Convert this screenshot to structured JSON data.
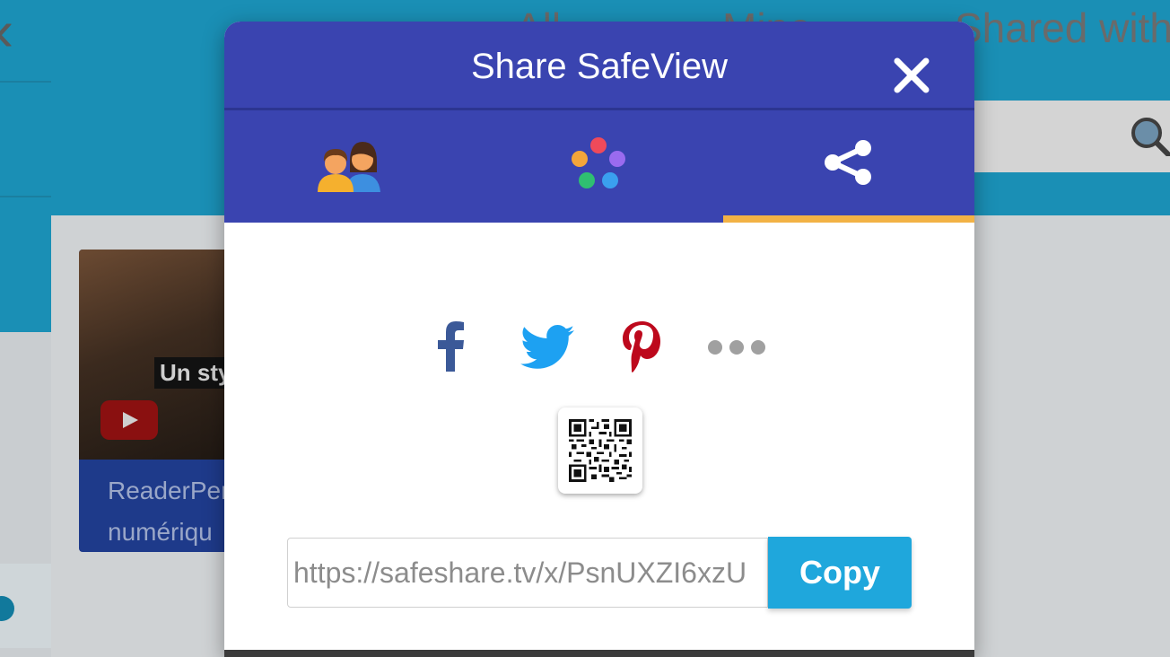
{
  "background": {
    "tabs": [
      "All",
      "Mine",
      "Shared with"
    ],
    "card_caption": "Un sty",
    "card_title_lines": [
      "ReaderPer",
      "numériqu"
    ]
  },
  "modal": {
    "title": "Share SafeView",
    "close_icon": "close-icon",
    "tabs": [
      {
        "icon": "people-icon",
        "active": false
      },
      {
        "icon": "colorful-dots-icon",
        "active": false
      },
      {
        "icon": "share-icon",
        "active": true
      }
    ],
    "social": [
      "facebook-icon",
      "twitter-icon",
      "pinterest-icon",
      "more-icon"
    ],
    "qr_icon": "qr-code-icon",
    "share_url": "https://safeshare.tv/x/PsnUXZI6xzU",
    "copy_label": "Copy"
  },
  "colors": {
    "header": "#3a44b0",
    "active_tab_indicator": "#f2b245",
    "copy_button": "#1fa7dc",
    "facebook": "#3b5998",
    "twitter": "#1da1f2",
    "pinterest": "#bd081c"
  }
}
